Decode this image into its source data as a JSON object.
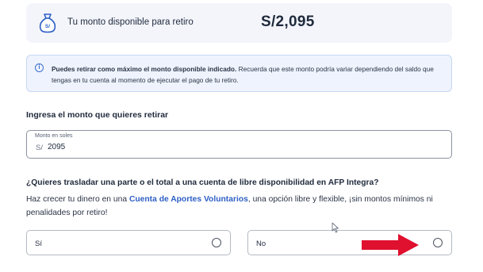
{
  "summary": {
    "label": "Tu monto disponible para retiro",
    "amount": "S/2,095",
    "icon_text": "S/"
  },
  "info": {
    "bold_text": "Puedes retirar como máximo el monto disponible indicado.",
    "text": " Recuerda que este monto podría variar dependiendo del saldo que tengas en tu cuenta al momento de ejecutar el pago de tu retiro.",
    "icon": "info-icon"
  },
  "withdraw": {
    "question": "Ingresa el monto que quieres retirar",
    "field_label": "Monto en soles",
    "prefix": "S/",
    "value": "2095"
  },
  "transfer": {
    "question": "¿Quieres trasladar una parte o el total a una cuenta de libre disponibilidad en AFP Integra?",
    "desc_before": "Haz crecer tu dinero en una ",
    "link_text": "Cuenta de Aportes Voluntarios",
    "desc_after": ", una opción libre y flexible, ¡sin montos mínimos ni penalidades por retiro!",
    "options": [
      {
        "label": "Sí",
        "selected": false
      },
      {
        "label": "No",
        "selected": false
      }
    ]
  },
  "colors": {
    "accent": "#2d5fc4",
    "arrow": "#e0102f",
    "card_bg": "#f3f5fb",
    "info_bg": "#eef3fd"
  }
}
